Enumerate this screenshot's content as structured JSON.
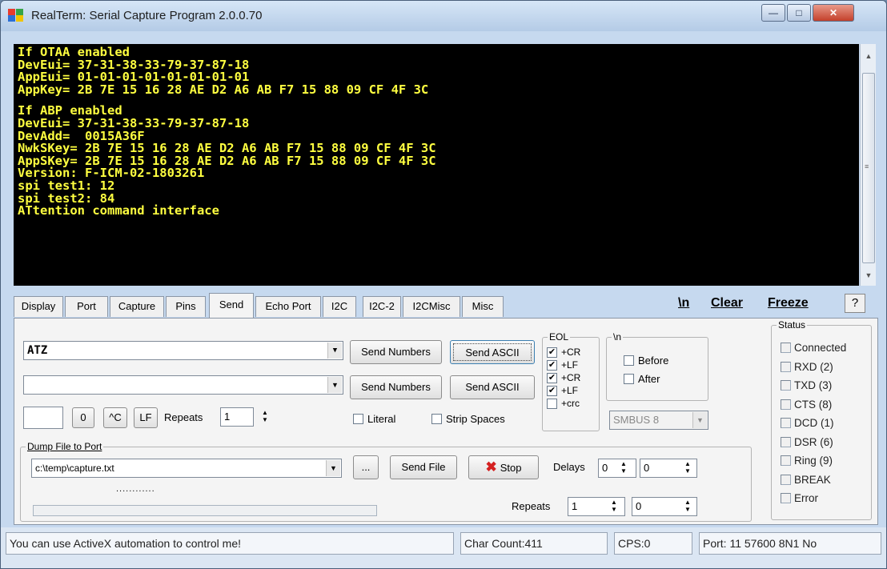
{
  "window": {
    "title": "RealTerm: Serial Capture Program 2.0.0.70"
  },
  "terminal": {
    "lines_a": [
      "If OTAA enabled",
      "DevEui= 37-31-38-33-79-37-87-18",
      "AppEui= 01-01-01-01-01-01-01-01",
      "AppKey= 2B 7E 15 16 28 AE D2 A6 AB F7 15 88 09 CF 4F 3C"
    ],
    "lines_b": [
      "If ABP enabled",
      "DevEui= 37-31-38-33-79-37-87-18",
      "DevAdd=  0015A36F",
      "NwkSKey= 2B 7E 15 16 28 AE D2 A6 AB F7 15 88 09 CF 4F 3C",
      "AppSKey= 2B 7E 15 16 28 AE D2 A6 AB F7 15 88 09 CF 4F 3C",
      "Version: F-ICM-02-1803261",
      "spi test1: 12",
      "spi test2: 84",
      "ATtention command interface"
    ]
  },
  "tabs": [
    "Display",
    "Port",
    "Capture",
    "Pins",
    "Send",
    "Echo Port",
    "I2C",
    "I2C-2",
    "I2CMisc",
    "Misc"
  ],
  "toolbar": {
    "newline": "\\n",
    "clear": "Clear",
    "freeze": "Freeze",
    "help": "?"
  },
  "send": {
    "line1_value": "ATZ",
    "line2_value": "",
    "send_numbers": "Send Numbers",
    "send_ascii": "Send ASCII",
    "zero_label": "0",
    "ctrl_c_label": "^C",
    "lf_label": "LF",
    "repeats_label": "Repeats",
    "repeats_value": "1",
    "literal": "Literal",
    "strip_spaces": "Strip Spaces"
  },
  "eol": {
    "legend": "EOL",
    "items": [
      "+CR",
      "+LF",
      "+CR",
      "+LF",
      "+crc"
    ],
    "checked": [
      true,
      true,
      true,
      true,
      false
    ]
  },
  "newline_group": {
    "legend": "\\n",
    "before": "Before",
    "after": "After"
  },
  "smbus": {
    "value": "SMBUS 8"
  },
  "dump": {
    "legend": "Dump File to Port",
    "file": "c:\\temp\\capture.txt",
    "browse": "...",
    "send_file": "Send File",
    "stop": "Stop",
    "delays_label": "Delays",
    "delay1": "0",
    "delay2": "0",
    "repeats_label": "Repeats",
    "repeats1": "1",
    "repeats2": "0",
    "dots": "............"
  },
  "status": {
    "legend": "Status",
    "items": [
      "Connected",
      "RXD (2)",
      "TXD (3)",
      "CTS (8)",
      "DCD (1)",
      "DSR (6)",
      "Ring (9)",
      "BREAK",
      "Error"
    ]
  },
  "statusbar": {
    "message": "You can use ActiveX automation to control me!",
    "char_count": "Char Count:411",
    "cps": "CPS:0",
    "port": "Port: 11 57600 8N1 No"
  }
}
